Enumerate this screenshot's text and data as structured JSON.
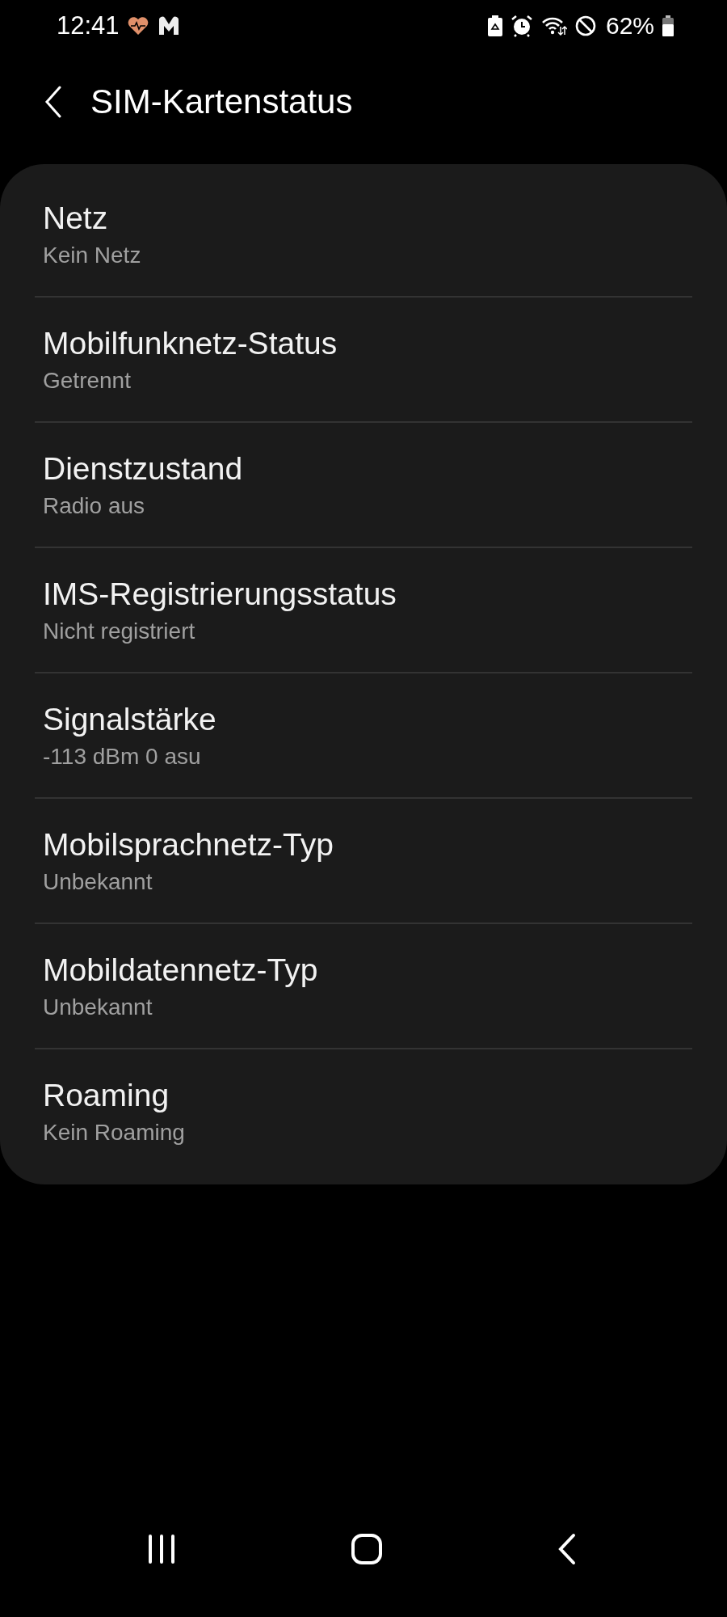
{
  "status_bar": {
    "time": "12:41",
    "battery": "62%"
  },
  "header": {
    "title": "SIM-Kartenstatus"
  },
  "items": [
    {
      "title": "Netz",
      "value": "Kein Netz"
    },
    {
      "title": "Mobilfunknetz-Status",
      "value": "Getrennt"
    },
    {
      "title": "Dienstzustand",
      "value": "Radio aus"
    },
    {
      "title": "IMS-Registrierungsstatus",
      "value": "Nicht registriert"
    },
    {
      "title": "Signalstärke",
      "value": "-113 dBm 0 asu"
    },
    {
      "title": "Mobilsprachnetz-Typ",
      "value": "Unbekannt"
    },
    {
      "title": "Mobildatennetz-Typ",
      "value": "Unbekannt"
    },
    {
      "title": "Roaming",
      "value": "Kein Roaming"
    }
  ]
}
